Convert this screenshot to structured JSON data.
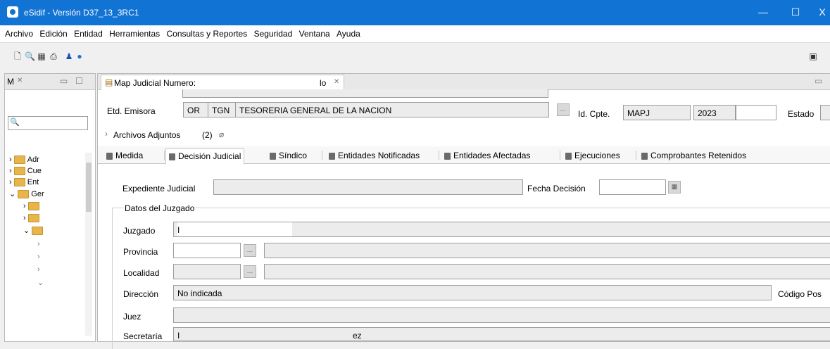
{
  "window": {
    "title": "eSidif - Versión D37_13_3RC1",
    "minimize": "—",
    "maximize": "☐",
    "close": "X"
  },
  "menu": [
    "Archivo",
    "Edición",
    "Entidad",
    "Herramientas",
    "Consultas y Reportes",
    "Seguridad",
    "Ventana",
    "Ayuda"
  ],
  "left_panel": {
    "tab_label": "M",
    "tree": [
      "Adr",
      "Cue",
      "Ent",
      "Ger"
    ]
  },
  "editor": {
    "tab_title": "Map Judicial Numero: ",
    "tab_title_suffix": "lo",
    "header": {
      "etd_emisora_label": "Etd. Emisora",
      "etd_emisora_code1": "OR",
      "etd_emisora_code2": "TGN",
      "etd_emisora_name": "TESORERIA GENERAL DE LA NACION",
      "id_cpte_label": "Id. Cpte.",
      "id_cpte_type": "MAPJ",
      "id_cpte_year": "2023",
      "estado_label": "Estado",
      "archivos_label": "Archivos Adjuntos",
      "archivos_count": "(2)"
    },
    "tabs": [
      "Medida",
      "Decisión Judicial",
      "Síndico",
      "Entidades Notificadas",
      "Entidades Afectadas",
      "Ejecuciones",
      "Comprobantes Retenidos"
    ],
    "active_tab": "Decisión Judicial",
    "form": {
      "expediente_label": "Expediente Judicial",
      "fecha_label": "Fecha Decisión",
      "group_title": "Datos del Juzgado",
      "juzgado_label": "Juzgado",
      "juzgado_value": "I",
      "provincia_label": "Provincia",
      "localidad_label": "Localidad",
      "direccion_label": "Dirección",
      "direccion_value": "No indicada",
      "codigo_postal_label": "Código Pos",
      "juez_label": "Juez",
      "secretaria_label": "Secretaría",
      "secretaria_value_start": "I",
      "secretaria_value_end": "ez"
    }
  }
}
